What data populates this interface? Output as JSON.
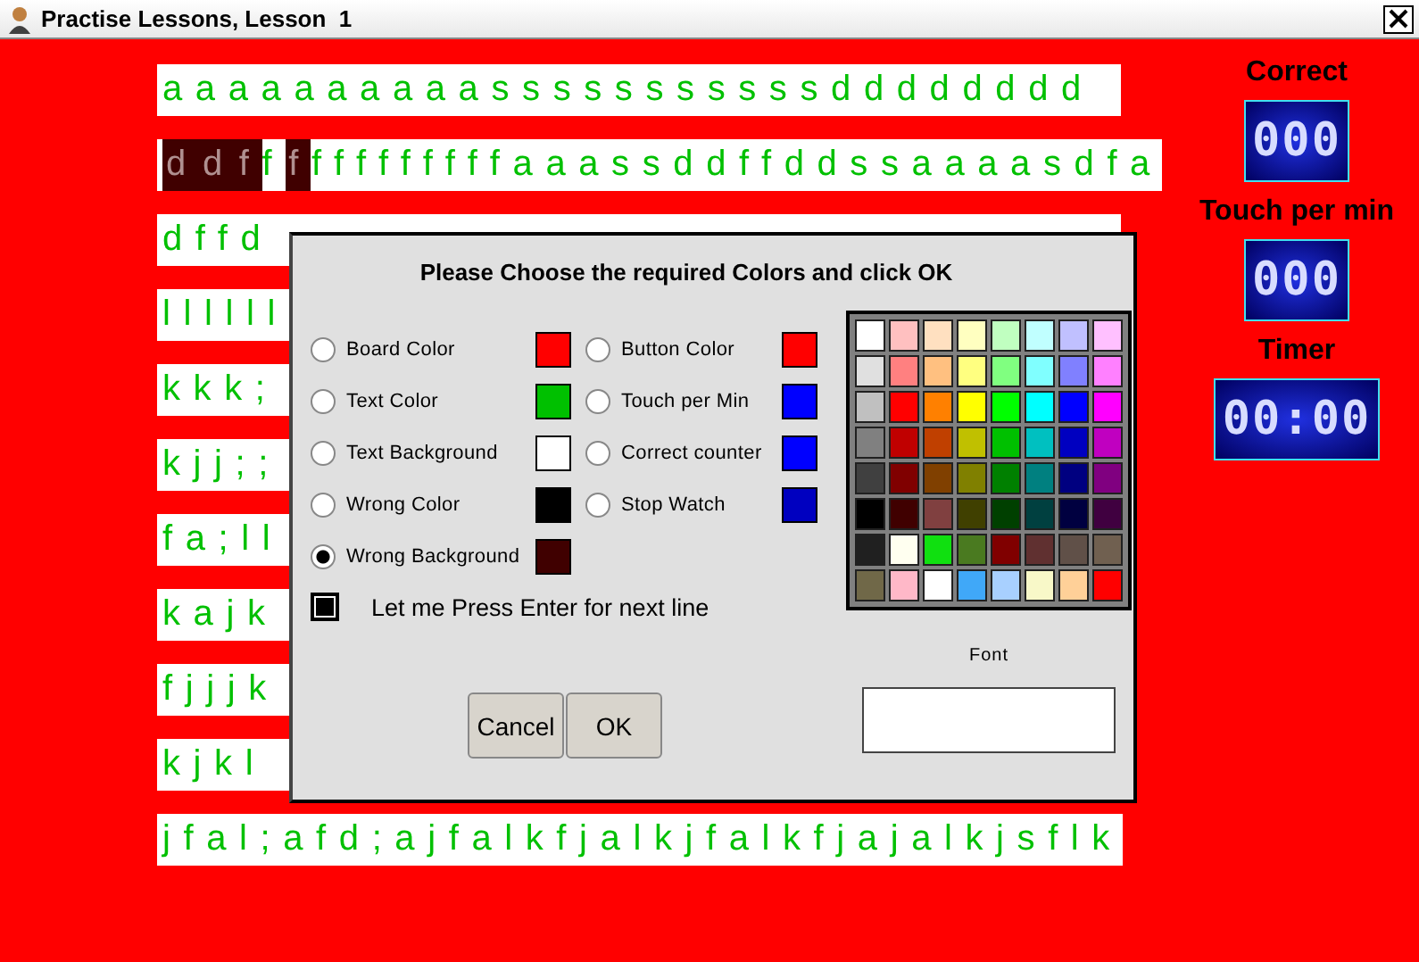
{
  "window": {
    "title": "Practise Lessons, Lesson  1"
  },
  "lines": [
    {
      "segments": [
        {
          "text": "aaaaaaaaaasssssssssssdddddddd",
          "wrong": false
        }
      ]
    },
    {
      "segments": [
        {
          "text": "d",
          "wrong": true
        },
        {
          "text": "d",
          "wrong": true
        },
        {
          "text": "f",
          "wrong": true
        },
        {
          "text": "f",
          "wrong": false
        },
        {
          "text": "f",
          "wrong": true
        },
        {
          "text": "fffffffffaaassddffddssaaaasdfa",
          "wrong": false
        }
      ]
    },
    {
      "segments": [
        {
          "text": "dffd",
          "wrong": false
        }
      ]
    },
    {
      "segments": [
        {
          "text": "llllll",
          "wrong": false
        }
      ]
    },
    {
      "segments": [
        {
          "text": "kkk;",
          "wrong": false
        }
      ]
    },
    {
      "segments": [
        {
          "text": "kjj;;",
          "wrong": false
        }
      ]
    },
    {
      "segments": [
        {
          "text": "fa;ll",
          "wrong": false
        }
      ]
    },
    {
      "segments": [
        {
          "text": "kajk",
          "wrong": false
        }
      ]
    },
    {
      "segments": [
        {
          "text": "fjjjk",
          "wrong": false
        }
      ]
    },
    {
      "segments": [
        {
          "text": "kjkl",
          "wrong": false
        }
      ]
    },
    {
      "segments": [
        {
          "text": "jfal;afd;ajfalkfjalkjfalkfjajalkjsflk",
          "wrong": false
        }
      ]
    }
  ],
  "counters": [
    {
      "label": "Correct",
      "display": "000"
    },
    {
      "label": "Touch per min",
      "display": "000"
    },
    {
      "label": "Timer",
      "display": "00:00"
    }
  ],
  "dialog": {
    "title": "Please Choose the required Colors and click OK",
    "options": [
      {
        "label": "Board Color",
        "color": "#ff0000",
        "selected": false
      },
      {
        "label": "Button Color",
        "color": "#ff0000",
        "selected": false
      },
      {
        "label": "Text Color",
        "color": "#00c000",
        "selected": false
      },
      {
        "label": "Touch per Min",
        "color": "#0000ff",
        "selected": false
      },
      {
        "label": "Text Background",
        "color": "#ffffff",
        "selected": false
      },
      {
        "label": "Correct counter",
        "color": "#0000ff",
        "selected": false
      },
      {
        "label": "Wrong Color",
        "color": "#000000",
        "selected": false
      },
      {
        "label": "Stop Watch",
        "color": "#0000c0",
        "selected": false
      },
      {
        "label": "Wrong Background",
        "color": "#400000",
        "selected": true
      }
    ],
    "enter_option": {
      "label": "Let me Press Enter for next line",
      "checked": true
    },
    "palette": [
      {
        "color": "#ffffff"
      },
      {
        "color": "#ffc0c0"
      },
      {
        "color": "#ffe0c0"
      },
      {
        "color": "#ffffc0"
      },
      {
        "color": "#c0ffc0"
      },
      {
        "color": "#c0ffff"
      },
      {
        "color": "#c0c0ff"
      },
      {
        "color": "#ffc0ff"
      },
      {
        "color": "#e0e0e0"
      },
      {
        "color": "#ff8080"
      },
      {
        "color": "#ffc080"
      },
      {
        "color": "#ffff80"
      },
      {
        "color": "#80ff80"
      },
      {
        "color": "#80ffff"
      },
      {
        "color": "#8080ff"
      },
      {
        "color": "#ff80ff"
      },
      {
        "color": "#c0c0c0"
      },
      {
        "color": "#ff0000"
      },
      {
        "color": "#ff8000"
      },
      {
        "color": "#ffff00"
      },
      {
        "color": "#00ff00"
      },
      {
        "color": "#00ffff"
      },
      {
        "color": "#0000ff"
      },
      {
        "color": "#ff00ff"
      },
      {
        "color": "#808080"
      },
      {
        "color": "#c00000"
      },
      {
        "color": "#c04000"
      },
      {
        "color": "#c0c000"
      },
      {
        "color": "#00c000"
      },
      {
        "color": "#00c0c0"
      },
      {
        "color": "#0000c0"
      },
      {
        "color": "#c000c0"
      },
      {
        "color": "#404040"
      },
      {
        "color": "#800000"
      },
      {
        "color": "#804000"
      },
      {
        "color": "#808000"
      },
      {
        "color": "#008000"
      },
      {
        "color": "#008080"
      },
      {
        "color": "#000080"
      },
      {
        "color": "#800080"
      },
      {
        "color": "#000000"
      },
      {
        "color": "#400000"
      },
      {
        "color": "#804040"
      },
      {
        "color": "#404000"
      },
      {
        "color": "#004000"
      },
      {
        "color": "#004040"
      },
      {
        "color": "#000040"
      },
      {
        "color": "#400040"
      },
      {
        "color": "#202020"
      },
      {
        "color": "#fffff0"
      },
      {
        "color": "#10e010"
      },
      {
        "color": "#4a7a20"
      },
      {
        "color": "#800000"
      },
      {
        "color": "#603030"
      },
      {
        "color": "#605048"
      },
      {
        "color": "#706050"
      },
      {
        "color": "#706848"
      },
      {
        "color": "#ffb8c8"
      },
      {
        "color": "#ffffff"
      },
      {
        "color": "#40a8f8"
      },
      {
        "color": "#a8d0ff"
      },
      {
        "color": "#f8f8c8"
      },
      {
        "color": "#ffd098"
      },
      {
        "color": "#ff0000"
      }
    ],
    "font_label": "Font",
    "buttons": [
      "Cancel",
      "OK"
    ]
  }
}
